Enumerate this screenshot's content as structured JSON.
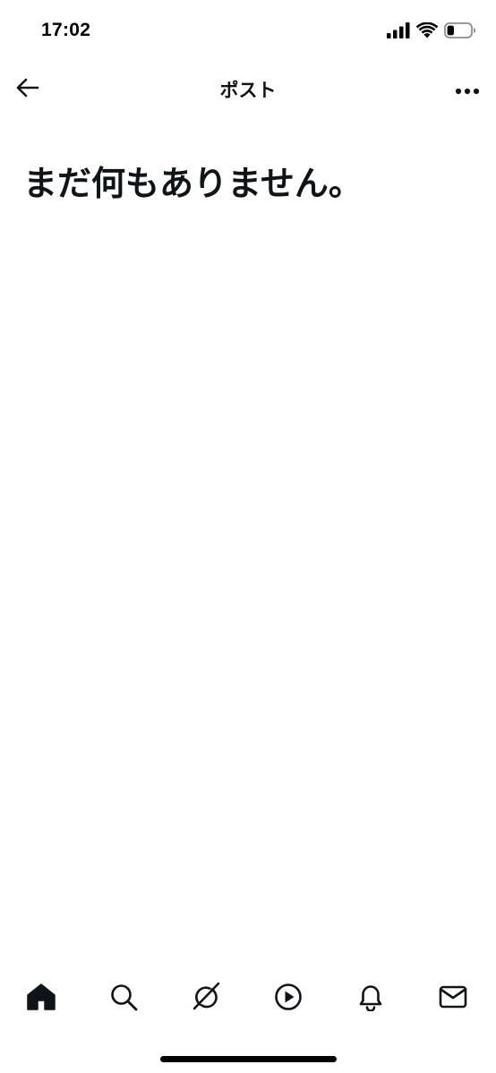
{
  "status_bar": {
    "time": "17:02",
    "icons": [
      "cellular-signal-icon",
      "wifi-icon",
      "battery-icon"
    ],
    "battery_level": 0.3
  },
  "header": {
    "back_icon": "arrow-left-icon",
    "title": "ポスト",
    "more_icon": "more-horizontal-icon"
  },
  "main": {
    "empty_title": "まだ何もありません。"
  },
  "bottom_nav": {
    "items": [
      {
        "name": "home",
        "icon": "home-icon",
        "active": true
      },
      {
        "name": "search",
        "icon": "search-icon",
        "active": false
      },
      {
        "name": "grok",
        "icon": "grok-icon",
        "active": false
      },
      {
        "name": "video",
        "icon": "play-circle-icon",
        "active": false
      },
      {
        "name": "notifications",
        "icon": "bell-icon",
        "active": false
      },
      {
        "name": "messages",
        "icon": "mail-icon",
        "active": false
      }
    ]
  },
  "colors": {
    "text": "#0f1419",
    "background": "#ffffff"
  }
}
